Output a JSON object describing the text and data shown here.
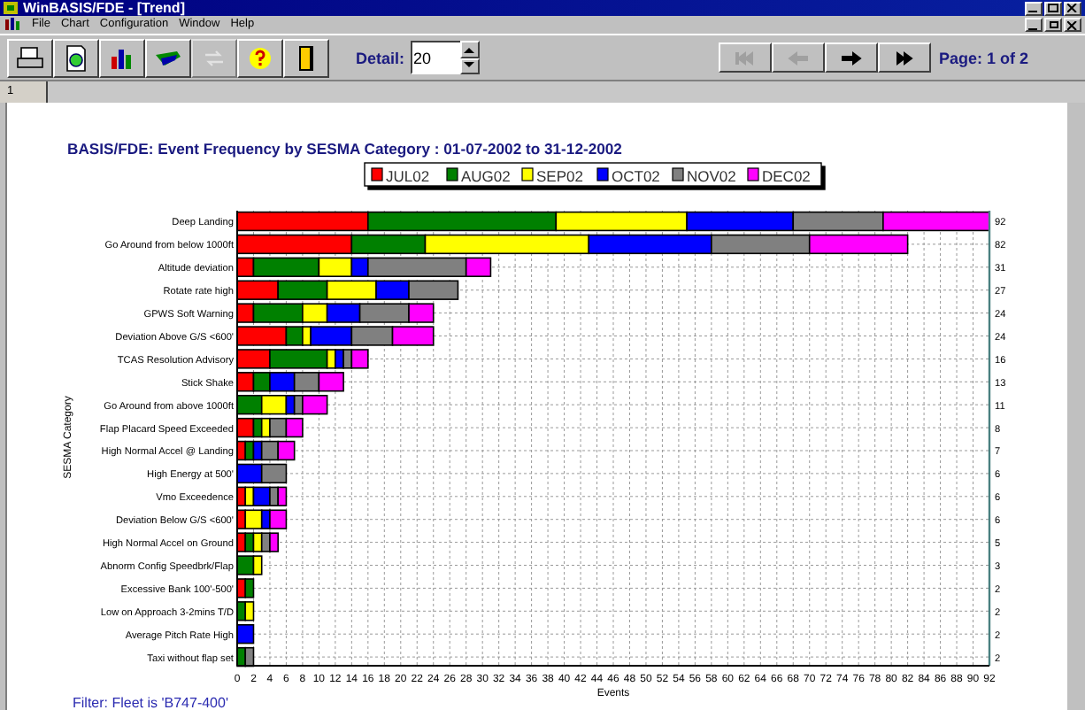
{
  "window": {
    "title": "WinBASIS/FDE - [Trend]"
  },
  "menu": [
    "File",
    "Chart",
    "Configuration",
    "Window",
    "Help"
  ],
  "toolbar": {
    "buttons": [
      {
        "kind": "print",
        "disabled": false
      },
      {
        "kind": "globe",
        "disabled": false
      },
      {
        "kind": "chart",
        "disabled": false
      },
      {
        "kind": "plane",
        "disabled": false
      },
      {
        "kind": "refresh",
        "disabled": true
      },
      {
        "kind": "help",
        "disabled": false
      },
      {
        "kind": "exit",
        "disabled": false
      }
    ],
    "detail": {
      "label": "Detail:",
      "value": "20"
    },
    "nav": [
      {
        "kind": "first",
        "disabled": true
      },
      {
        "kind": "prev",
        "disabled": true
      },
      {
        "kind": "next",
        "disabled": false
      },
      {
        "kind": "last",
        "disabled": false
      }
    ],
    "page": "Page: 1 of 2"
  },
  "tabs": [
    {
      "label": "1",
      "selected": true
    }
  ],
  "chart": {
    "chart_data": {
      "type": "bar",
      "orientation": "horizontal",
      "stacked": true,
      "title": "BASIS/FDE: Event Frequency by SESMA Category : 01-07-2002 to 31-12-2002",
      "xlabel": "Events",
      "ylabel": "SESMA Category",
      "categories": [
        "Deep Landing",
        "Go Around from below 1000ft",
        "Altitude deviation",
        "Rotate rate high",
        "GPWS Soft Warning",
        "Deviation Above G/S <600'",
        "TCAS Resolution Advisory",
        "Stick Shake",
        "Go Around from above 1000ft",
        "Flap Placard Speed Exceeded",
        "High Normal Accel @ Landing",
        "High Energy at 500'",
        "Vmo Exceedence",
        "Deviation Below G/S <600'",
        "High Normal Accel on Ground",
        "Abnorm Config Speedbrk/Flap",
        "Excessive Bank 100'-500'",
        "Low on Approach 3-2mins T/D",
        "Average Pitch Rate High",
        "Taxi without flap set"
      ],
      "series": [
        {
          "name": "JUL02",
          "color": "#ff0000",
          "values": [
            16,
            14,
            2,
            5,
            2,
            6,
            4,
            2,
            0,
            2,
            1,
            0,
            1,
            1,
            1,
            0,
            1,
            0,
            0,
            0
          ]
        },
        {
          "name": "AUG02",
          "color": "#008000",
          "values": [
            23,
            9,
            8,
            6,
            6,
            2,
            7,
            2,
            3,
            1,
            1,
            0,
            0,
            0,
            1,
            2,
            1,
            1,
            0,
            1
          ]
        },
        {
          "name": "SEP02",
          "color": "#ffff00",
          "values": [
            16,
            20,
            4,
            6,
            3,
            1,
            1,
            0,
            3,
            1,
            0,
            0,
            1,
            2,
            1,
            1,
            0,
            1,
            0,
            0
          ]
        },
        {
          "name": "OCT02",
          "color": "#0000ff",
          "values": [
            13,
            15,
            2,
            4,
            4,
            5,
            1,
            3,
            1,
            0,
            1,
            3,
            2,
            1,
            0,
            0,
            0,
            0,
            2,
            0
          ]
        },
        {
          "name": "NOV02",
          "color": "#808080",
          "values": [
            11,
            12,
            12,
            6,
            6,
            5,
            1,
            3,
            1,
            2,
            2,
            3,
            1,
            0,
            1,
            0,
            0,
            0,
            0,
            1
          ]
        },
        {
          "name": "DEC02",
          "color": "#ff00ff",
          "values": [
            13,
            12,
            3,
            0,
            3,
            5,
            2,
            3,
            3,
            2,
            2,
            0,
            1,
            2,
            1,
            0,
            0,
            0,
            0,
            0
          ]
        }
      ],
      "value_labels": [
        "92",
        "82",
        "31",
        "27",
        "24",
        "24",
        "16",
        "13",
        "11",
        "8",
        "7",
        "6",
        "6",
        "6",
        "5",
        "3",
        "2",
        "2",
        "2",
        "2"
      ],
      "xlim": [
        0,
        92
      ],
      "grid": true,
      "legend": true,
      "xticks": [
        0,
        2,
        4,
        6,
        8,
        10,
        12,
        14,
        16,
        18,
        20,
        22,
        24,
        26,
        28,
        30,
        32,
        34,
        36,
        38,
        40,
        42,
        44,
        46,
        48,
        50,
        52,
        54,
        56,
        58,
        60,
        62,
        64,
        66,
        68,
        70,
        72,
        74,
        76,
        78,
        80,
        82,
        84,
        86,
        88,
        90,
        92
      ]
    },
    "filter": "Filter: Fleet is 'B747-400'"
  }
}
